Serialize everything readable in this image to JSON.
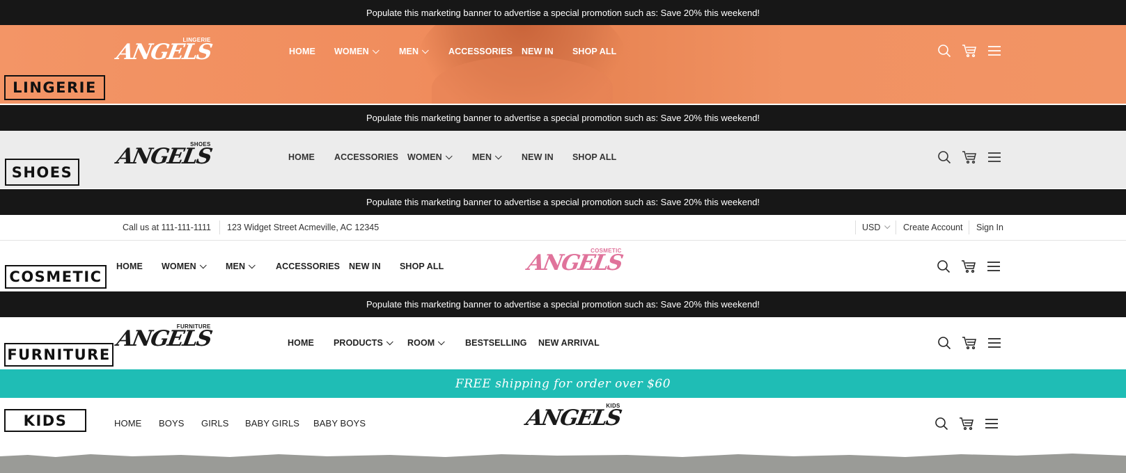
{
  "promo_text": "Populate this marketing banner to advertise a special promotion such as: Save 20% this weekend!",
  "brand": "ANGELS",
  "colors": {
    "banner": "#171717",
    "lingerie": "#f09060",
    "shoes": "#ececec",
    "kids_banner": "#1fbdb5",
    "cosmetic_logo": "#e0739b"
  },
  "lingerie": {
    "tag": "LINGERIE",
    "logo_sub": "LINGERIE",
    "nav": [
      {
        "label": "HOME"
      },
      {
        "label": "WOMEN",
        "dropdown": true
      },
      {
        "label": "MEN",
        "dropdown": true
      },
      {
        "label": "ACCESSORIES"
      },
      {
        "label": "NEW IN"
      },
      {
        "label": "SHOP ALL"
      }
    ]
  },
  "shoes": {
    "tag": "SHOES",
    "logo_sub": "SHOES",
    "nav": [
      {
        "label": "HOME"
      },
      {
        "label": "ACCESSORIES"
      },
      {
        "label": "WOMEN",
        "dropdown": true
      },
      {
        "label": "MEN",
        "dropdown": true
      },
      {
        "label": "NEW IN"
      },
      {
        "label": "SHOP ALL"
      }
    ]
  },
  "cosmetic": {
    "tag": "COSMETIC",
    "logo_sub": "COSMETIC",
    "topbar": {
      "phone": "Call us at 111-111-1111",
      "address": "123 Widget Street Acmeville, AC 12345",
      "currency": "USD",
      "create_account": "Create Account",
      "sign_in": "Sign In"
    },
    "nav": [
      {
        "label": "HOME"
      },
      {
        "label": "WOMEN",
        "dropdown": true
      },
      {
        "label": "MEN",
        "dropdown": true
      },
      {
        "label": "ACCESSORIES"
      },
      {
        "label": "NEW IN"
      },
      {
        "label": "SHOP ALL"
      }
    ]
  },
  "furniture": {
    "tag": "FURNITURE",
    "logo_sub": "FURNITURE",
    "nav": [
      {
        "label": "HOME"
      },
      {
        "label": "PRODUCTS",
        "dropdown": true
      },
      {
        "label": "ROOM",
        "dropdown": true
      },
      {
        "label": "BESTSELLING"
      },
      {
        "label": "NEW ARRIVAL"
      }
    ]
  },
  "kids": {
    "tag": "KIDS",
    "logo_sub": "KIDS",
    "shipping_banner": "FREE shipping for order over $60",
    "nav": [
      {
        "label": "HOME"
      },
      {
        "label": "BOYS"
      },
      {
        "label": "GIRLS"
      },
      {
        "label": "BABY GIRLS"
      },
      {
        "label": "BABY BOYS"
      }
    ]
  },
  "icons": [
    "search-icon",
    "cart-icon",
    "menu-icon"
  ]
}
